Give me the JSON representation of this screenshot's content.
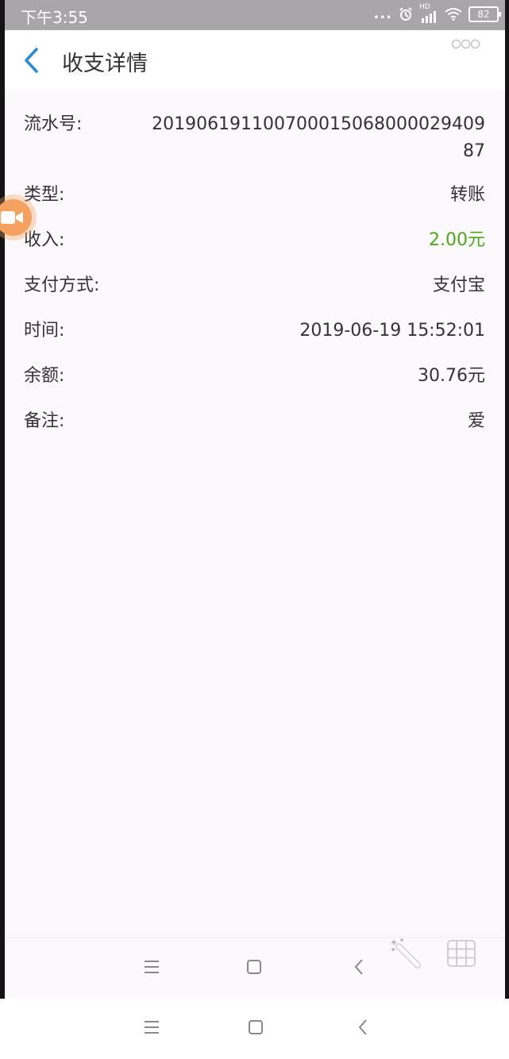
{
  "status_bar": {
    "time": "下午3:55",
    "dots": "...",
    "hd": "HD",
    "battery": "82"
  },
  "header": {
    "title": "收支详情"
  },
  "details": [
    {
      "label": "流水号:",
      "value": "2019061911007000150680000​2940987"
    },
    {
      "label": "类型:",
      "value": "转账"
    },
    {
      "label": "收入:",
      "value": "2.00元"
    },
    {
      "label": "支付方式:",
      "value": "支付宝"
    },
    {
      "label": "时间:",
      "value": "2019-06-19 15:52:01"
    },
    {
      "label": "余额:",
      "value": "30.76元"
    },
    {
      "label": "备注:",
      "value": "爱"
    }
  ],
  "colors": {
    "accent_blue": "#2b8ad8",
    "income_green": "#4da61e",
    "status_bar": "#a8a6a8"
  },
  "icons": {
    "back": "chevron-left-icon",
    "more": "more-icon",
    "float": "video-camera-icon",
    "menu": "menu-icon",
    "home": "square-icon",
    "back_nav": "chevron-left-icon",
    "wand": "magic-wand-icon",
    "grid": "grid-icon"
  }
}
